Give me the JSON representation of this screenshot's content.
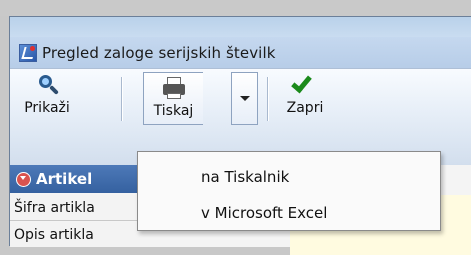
{
  "window": {
    "title": "Pregled zaloge serijskih številk",
    "icon": "app-grid-icon"
  },
  "toolbar": {
    "prikazi_label": "Prikaži",
    "tiskaj_label": "Tiskaj",
    "zapri_label": "Zapri",
    "icons": {
      "prikazi": "magnifier-icon",
      "tiskaj": "printer-icon",
      "dropdown": "chevron-down-icon",
      "zapri": "checkmark-icon"
    }
  },
  "panel": {
    "group_header": "Artikel",
    "fields": [
      {
        "label": "Šifra artikla"
      },
      {
        "label": "Opis artikla"
      }
    ]
  },
  "print_menu": {
    "items": [
      {
        "label": "na Tiskalnik"
      },
      {
        "label": "v Microsoft Excel"
      }
    ]
  },
  "colors": {
    "group_header_bg": "#3d6aa8",
    "checkmark": "#1b8a1b",
    "value_field_bg": "#fffbe0"
  }
}
